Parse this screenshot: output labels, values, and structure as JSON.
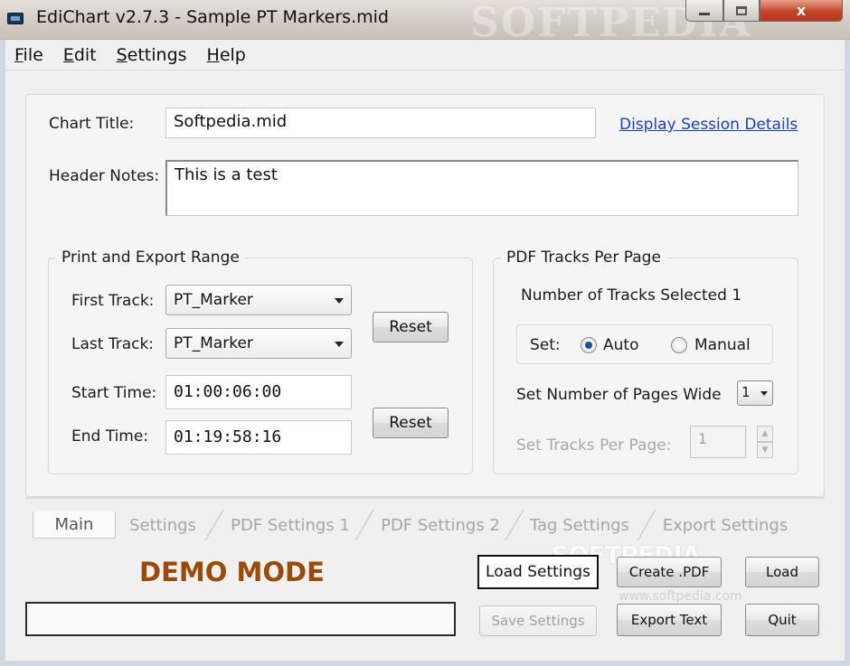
{
  "window": {
    "title": "EdiChart v2.7.3 - Sample PT Markers.mid",
    "watermark": "SOFTPEDIA",
    "controls": {
      "minimize": "",
      "maximize": "",
      "close": "x"
    }
  },
  "menu": {
    "items": [
      {
        "accel": "F",
        "rest": "ile"
      },
      {
        "accel": "E",
        "rest": "dit"
      },
      {
        "accel": "S",
        "rest": "ettings"
      },
      {
        "accel": "H",
        "rest": "elp"
      }
    ]
  },
  "main": {
    "chart_title_label": "Chart Title:",
    "chart_title_value": "Softpedia.mid",
    "session_link": "Display Session Details",
    "header_notes_label": "Header Notes:",
    "header_notes_value": "This is a test",
    "range": {
      "legend": "Print and Export Range",
      "first_track_label": "First Track:",
      "first_track_value": "PT_Marker",
      "last_track_label": "Last Track:",
      "last_track_value": "PT_Marker",
      "reset_tracks_label": "Reset",
      "start_time_label": "Start Time:",
      "start_time_value": "01:00:06:00",
      "end_time_label": "End Time:",
      "end_time_value": "01:19:58:16",
      "reset_times_label": "Reset"
    },
    "pdf_tracks": {
      "legend": "PDF Tracks Per Page",
      "tracks_selected_label": "Number of Tracks Selected",
      "tracks_selected_value": "1",
      "set_label": "Set:",
      "auto_label": "Auto",
      "manual_label": "Manual",
      "selected_mode": "Auto",
      "pages_wide_label": "Set Number of Pages Wide",
      "pages_wide_value": "1",
      "tracks_per_page_label": "Set Tracks Per Page:",
      "tracks_per_page_value": "1"
    }
  },
  "tabs": [
    {
      "label": "Main",
      "active": true
    },
    {
      "label": "Settings",
      "active": false
    },
    {
      "label": "PDF Settings 1",
      "active": false
    },
    {
      "label": "PDF Settings 2",
      "active": false
    },
    {
      "label": "Tag Settings",
      "active": false
    },
    {
      "label": "Export Settings",
      "active": false
    }
  ],
  "footer": {
    "demo_mode": "DEMO MODE",
    "load_settings": "Load Settings",
    "create_pdf": "Create .PDF",
    "load": "Load",
    "save_settings": "Save Settings",
    "export_text": "Export Text",
    "quit": "Quit",
    "watermark": "SOFTPEDIA",
    "watermark_url": "www.softpedia.com"
  },
  "colors": {
    "link": "#1a3fd1",
    "demo_mode": "#9a4a0a",
    "close_button": "#c4452a",
    "radio_dot": "#1f4f9c"
  }
}
